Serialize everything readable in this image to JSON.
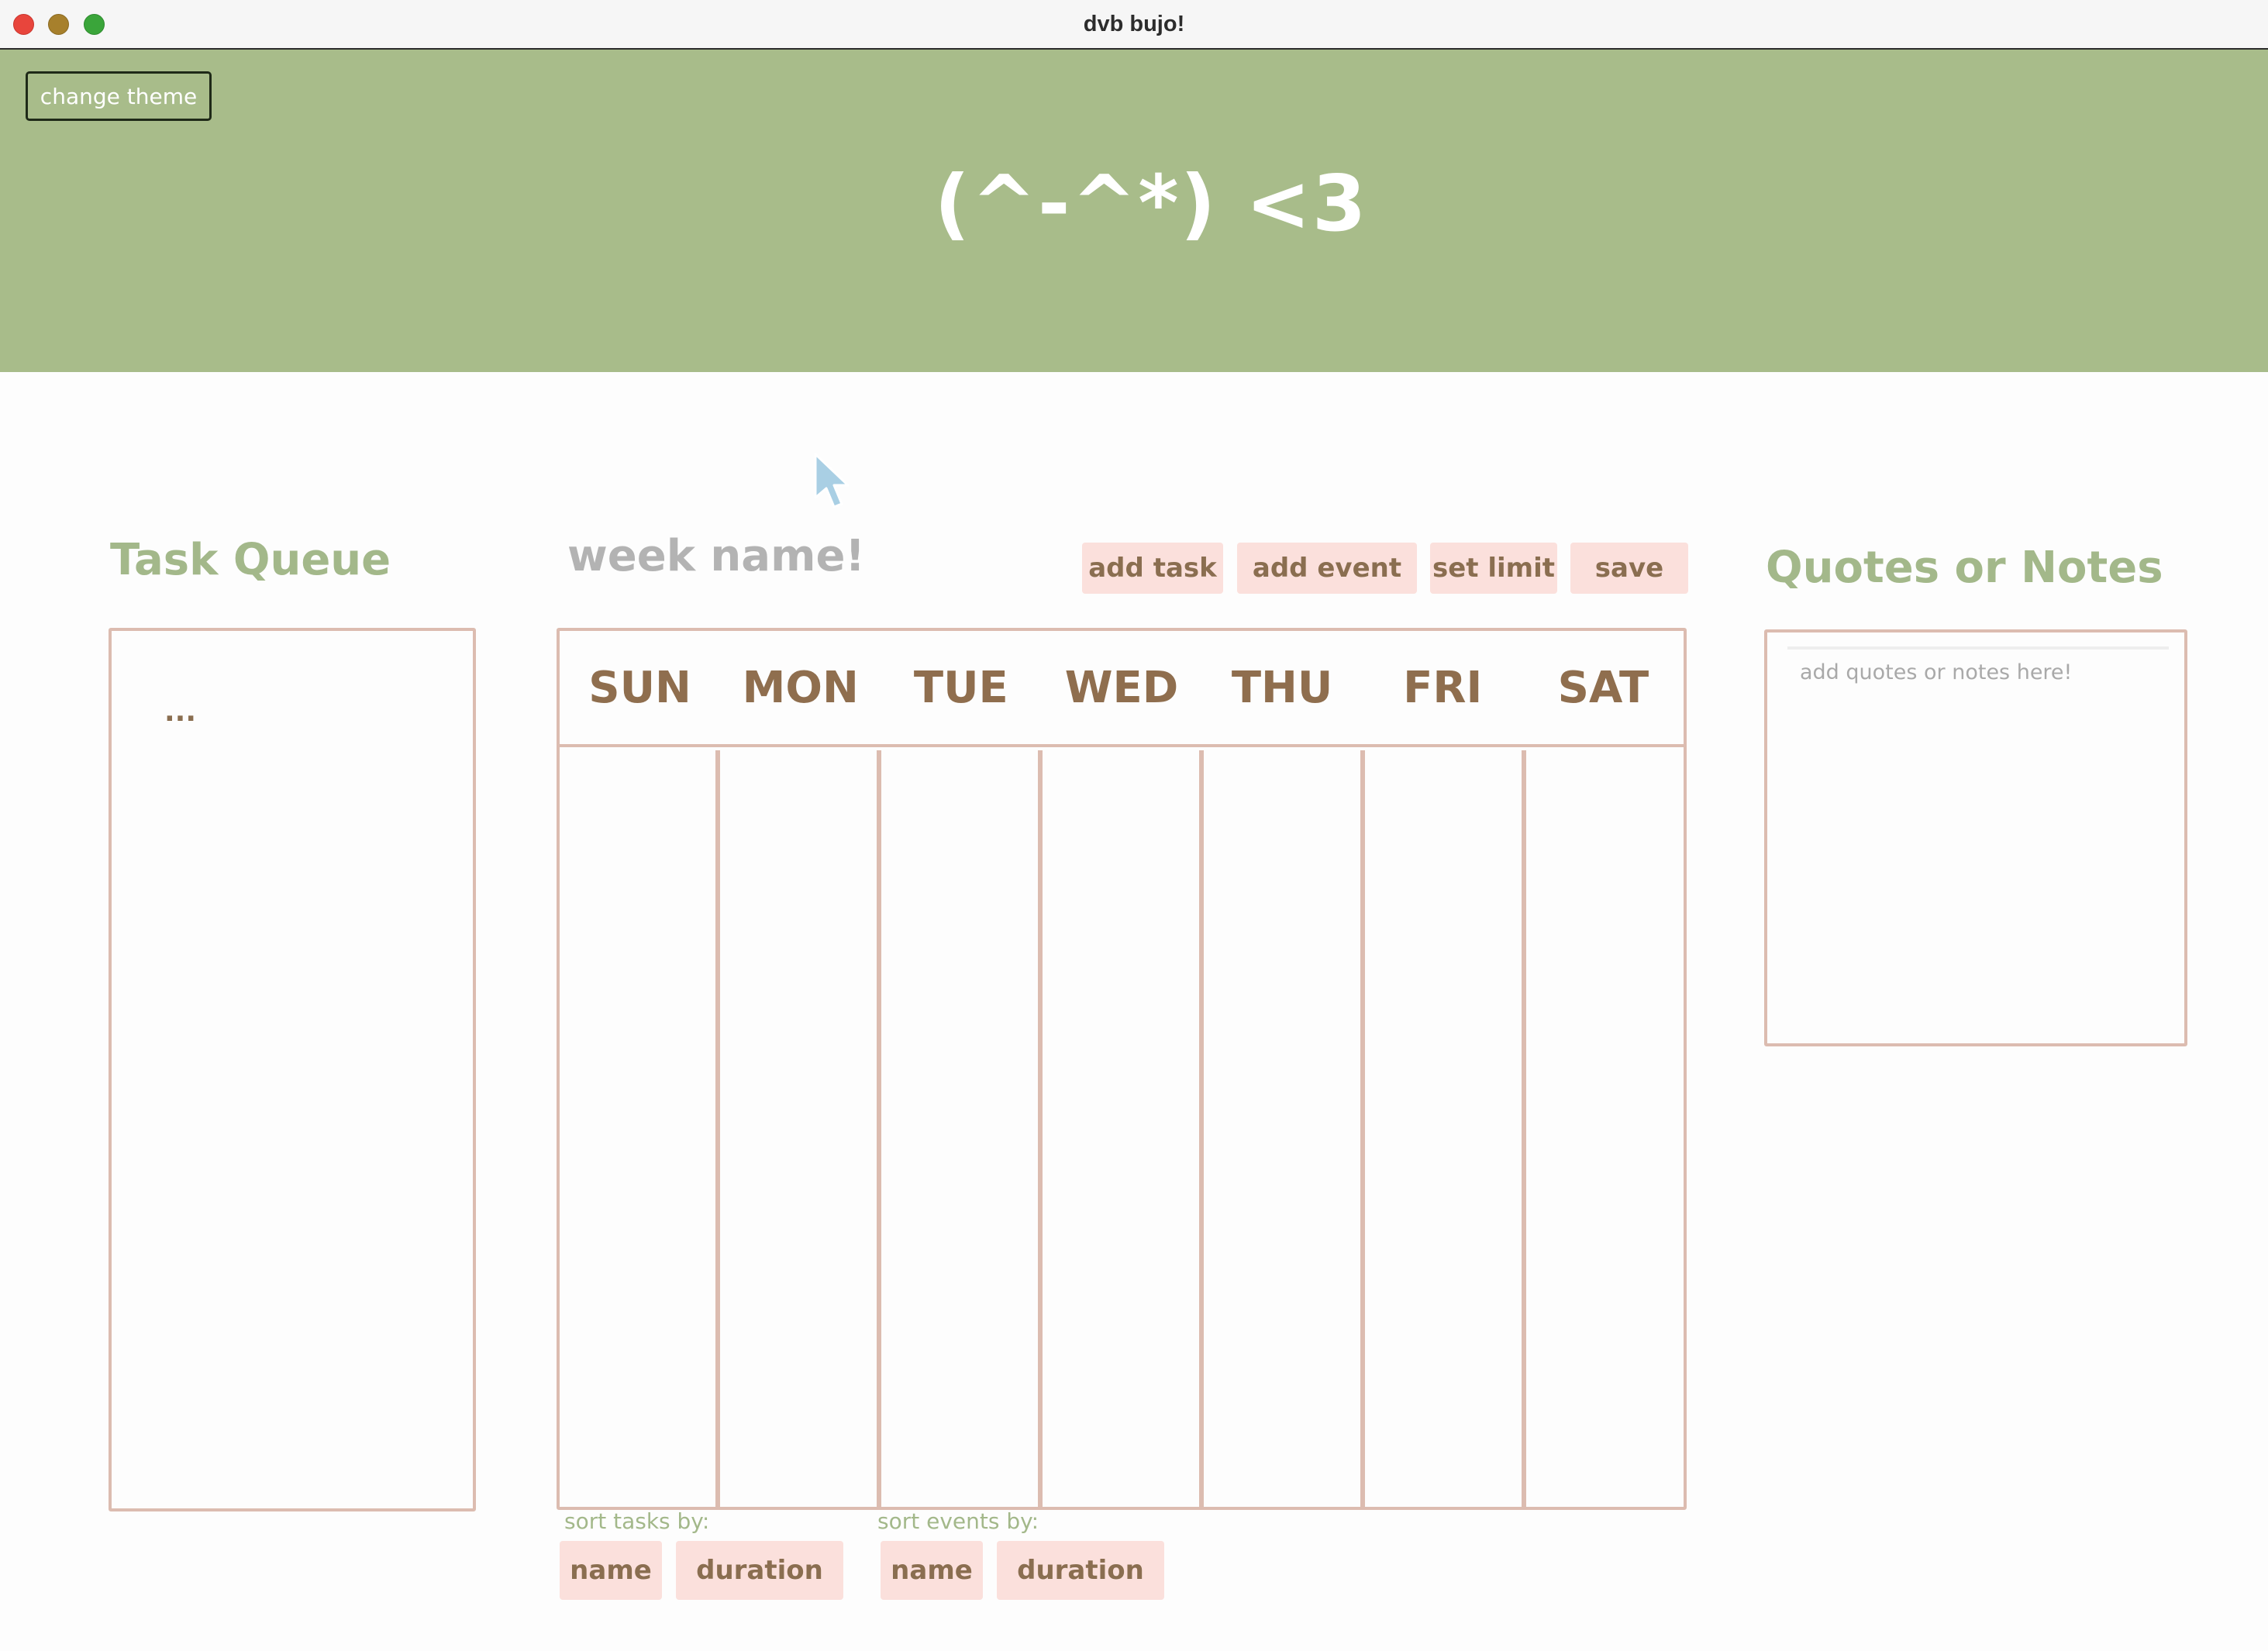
{
  "window": {
    "title": "dvb bujo!"
  },
  "banner": {
    "theme_button": "change theme",
    "kaomoji": "(^-^*) <3",
    "background_color": "#a8bc8a"
  },
  "task_queue": {
    "title": "Task Queue",
    "items": [
      "..."
    ]
  },
  "week": {
    "name_placeholder": "week name!",
    "actions": {
      "add_task": "add task",
      "add_event": "add event",
      "set_limit": "set limit",
      "save": "save"
    },
    "days": [
      "SUN",
      "MON",
      "TUE",
      "WED",
      "THU",
      "FRI",
      "SAT"
    ]
  },
  "sort": {
    "tasks_label": "sort tasks by:",
    "events_label": "sort events by:",
    "task_options": [
      "name",
      "duration"
    ],
    "event_options": [
      "name",
      "duration"
    ]
  },
  "notes": {
    "title": "Quotes or Notes",
    "placeholder": "add quotes or notes here!"
  },
  "colors": {
    "accent_green": "#a8bc8a",
    "button_pink": "#fbe0dc",
    "border_rose": "#dcbcb0",
    "text_brown": "#8a6e50"
  }
}
